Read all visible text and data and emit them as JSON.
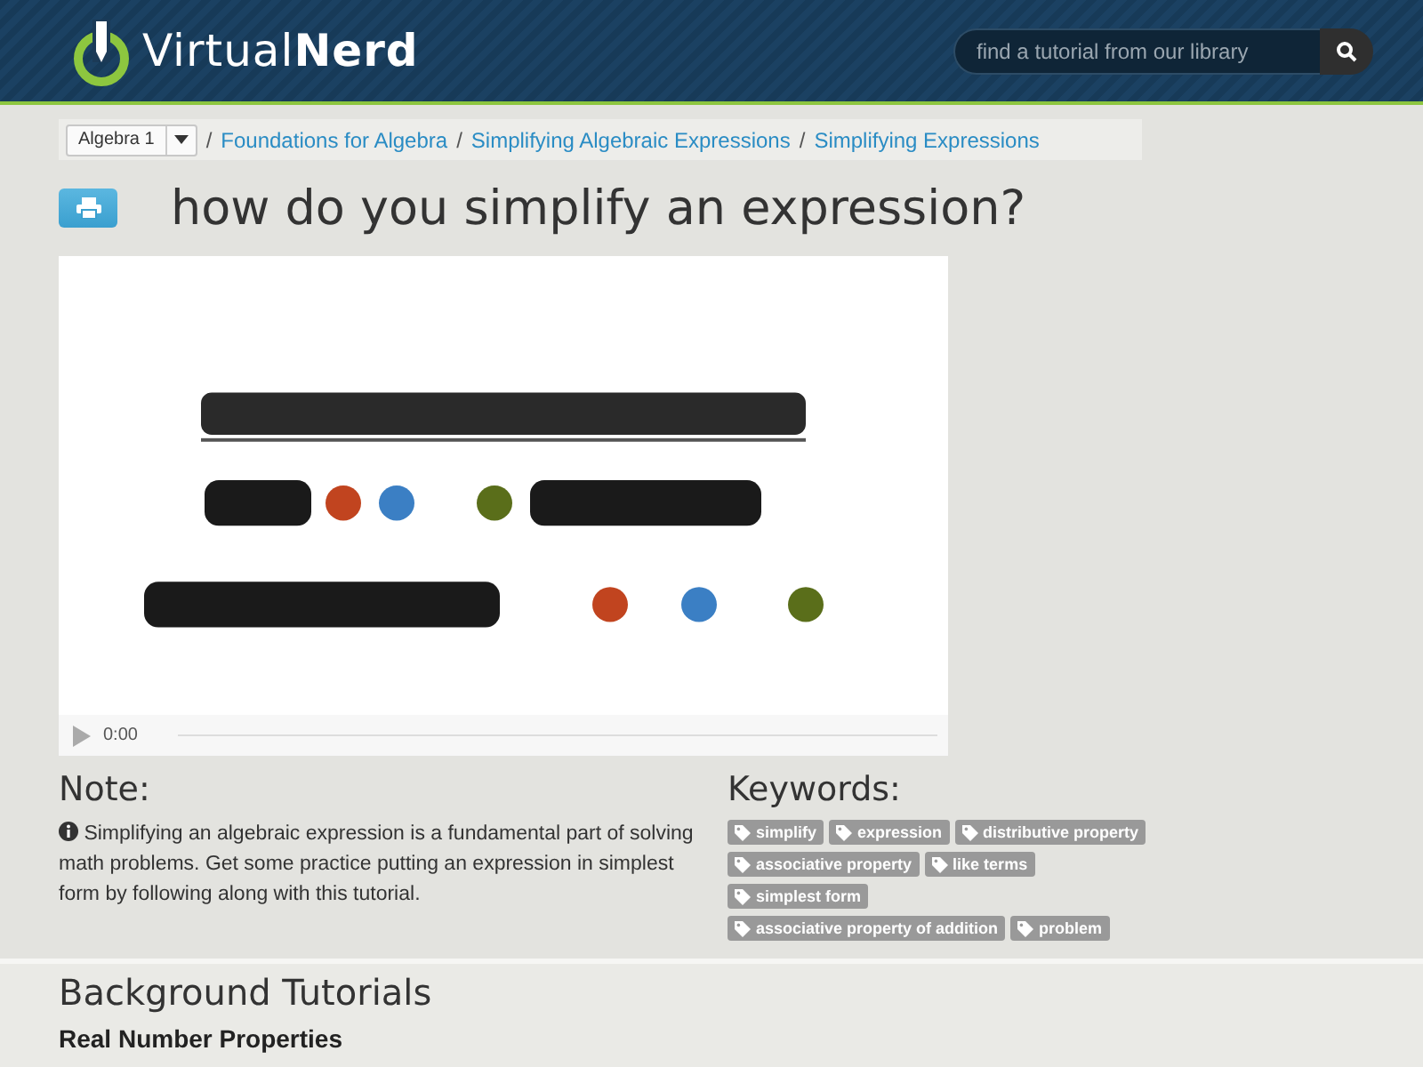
{
  "header": {
    "logo": {
      "light": "Virtual",
      "bold": "Nerd"
    },
    "search": {
      "placeholder": "find a tutorial from our library"
    }
  },
  "breadcrumb": {
    "course": "Algebra 1",
    "separator": "/",
    "links": [
      "Foundations for Algebra",
      "Simplifying Algebraic Expressions",
      "Simplifying Expressions"
    ]
  },
  "title": "how do you simplify an expression?",
  "video": {
    "kind": "picture",
    "time": "0:00"
  },
  "note": {
    "heading": "Note:",
    "text": "Simplifying an algebraic expression is a fundamental part of solving math problems. Get some practice putting an expression in simplest form by following along with this tutorial."
  },
  "keywords": {
    "heading": "Keywords:",
    "tags": [
      [
        "simplify",
        "expression",
        "distributive property"
      ],
      [
        "associative property",
        "like terms"
      ],
      [
        "simplest form"
      ],
      [
        "associative property of addition",
        "problem"
      ]
    ]
  },
  "background": {
    "heading": "Background Tutorials",
    "items": [
      "Real Number Properties"
    ]
  }
}
